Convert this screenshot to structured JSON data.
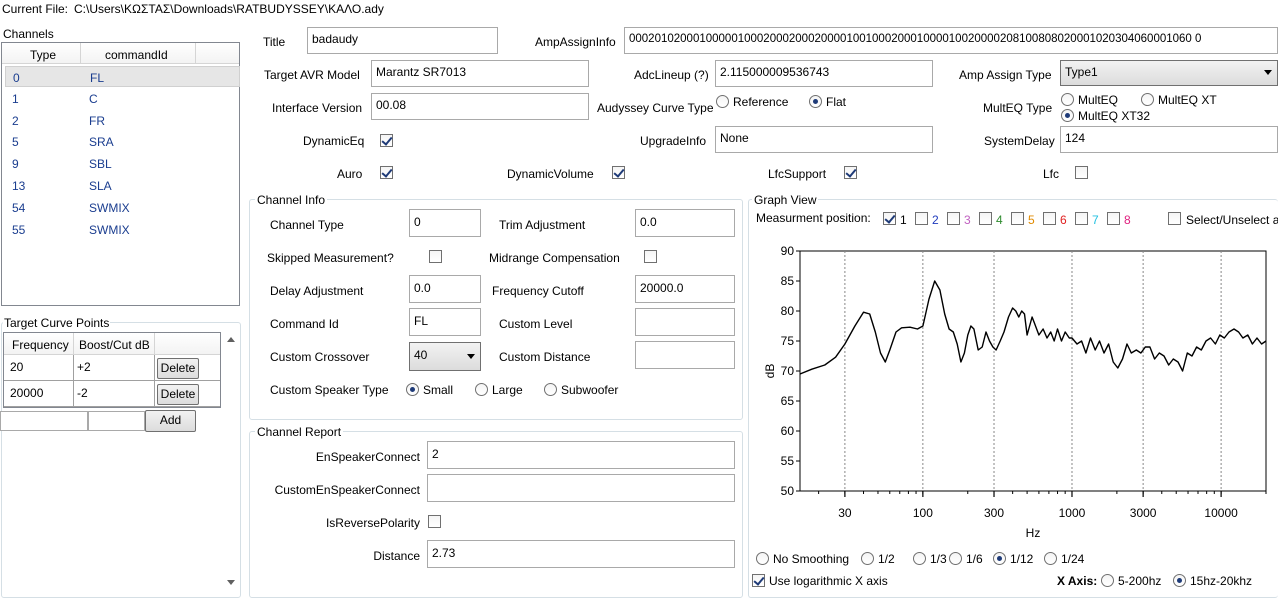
{
  "current_file": {
    "label": "Current File:",
    "path": "C:\\Users\\ΚΩΣΤΑΣ\\Downloads\\RATBUDYSSEY\\ΚΑΛΟ.ady"
  },
  "channels": {
    "title": "Channels",
    "headers": {
      "type": "Type",
      "command": "commandId"
    },
    "rows": [
      {
        "type": "0",
        "cmd": "FL"
      },
      {
        "type": "1",
        "cmd": "C"
      },
      {
        "type": "2",
        "cmd": "FR"
      },
      {
        "type": "5",
        "cmd": "SRA"
      },
      {
        "type": "9",
        "cmd": "SBL"
      },
      {
        "type": "13",
        "cmd": "SLA"
      },
      {
        "type": "54",
        "cmd": "SWMIX"
      },
      {
        "type": "55",
        "cmd": "SWMIX"
      }
    ]
  },
  "target_curve": {
    "title": "Target Curve Points",
    "headers": {
      "freq": "Frequency",
      "boost": "Boost/Cut dB"
    },
    "rows": [
      {
        "freq": "20",
        "boost": "+2",
        "del": "Delete"
      },
      {
        "freq": "20000",
        "boost": "-2",
        "del": "Delete"
      }
    ],
    "add_label": "Add"
  },
  "top": {
    "title_label": "Title",
    "title_value": "badaudy",
    "amp_assign_info_label": "AmpAssignInfo",
    "amp_assign_info_value": "0002010200010000010002000200020000100100020001000010020000208100808020001020304060001060 0",
    "target_avr_label": "Target AVR Model",
    "target_avr_value": "Marantz SR7013",
    "adc_lineup_label": "AdcLineup (?)",
    "adc_lineup_value": "2.115000009536743",
    "amp_assign_type_label": "Amp Assign Type",
    "amp_assign_type_value": "Type1",
    "interface_version_label": "Interface Version",
    "interface_version_value": "00.08",
    "audyssey_curve_label": "Audyssey Curve Type",
    "curve_reference": "Reference",
    "curve_flat": "Flat",
    "multeq_type_label": "MultEQ Type",
    "multeq": "MultEQ",
    "multeq_xt": "MultEQ XT",
    "multeq_xt32": "MultEQ XT32",
    "dynamic_eq_label": "DynamicEq",
    "upgrade_info_label": "UpgradeInfo",
    "upgrade_info_value": "None",
    "system_delay_label": "SystemDelay",
    "system_delay_value": "124",
    "auro_label": "Auro",
    "dynamic_volume_label": "DynamicVolume",
    "lfc_support_label": "LfcSupport",
    "lfc_label": "Lfc"
  },
  "channel_info": {
    "title": "Channel Info",
    "channel_type_label": "Channel Type",
    "channel_type_value": "0",
    "trim_label": "Trim Adjustment",
    "trim_value": "0.0",
    "skipped_label": "Skipped Measurement?",
    "midrange_label": "Midrange Compensation",
    "delay_label": "Delay Adjustment",
    "delay_value": "0.0",
    "freq_cutoff_label": "Frequency Cutoff",
    "freq_cutoff_value": "20000.0",
    "command_id_label": "Command Id",
    "command_id_value": "FL",
    "custom_level_label": "Custom Level",
    "custom_level_value": "",
    "custom_crossover_label": "Custom Crossover",
    "custom_crossover_value": "40",
    "custom_distance_label": "Custom Distance",
    "custom_distance_value": "",
    "speaker_type_label": "Custom Speaker Type",
    "small": "Small",
    "large": "Large",
    "subwoofer": "Subwoofer"
  },
  "channel_report": {
    "title": "Channel Report",
    "en_speaker_label": "EnSpeakerConnect",
    "en_speaker_value": "2",
    "custom_en_label": "CustomEnSpeakerConnect",
    "custom_en_value": "",
    "reverse_label": "IsReversePolarity",
    "distance_label": "Distance",
    "distance_value": "2.73"
  },
  "graph": {
    "title": "Graph View",
    "measurement_label": "Measurment position:",
    "positions": [
      {
        "n": "1",
        "color": "#000000",
        "checked": true
      },
      {
        "n": "2",
        "color": "#1f3bbd",
        "checked": false
      },
      {
        "n": "3",
        "color": "#c060c0",
        "checked": false
      },
      {
        "n": "4",
        "color": "#2e8b2e",
        "checked": false
      },
      {
        "n": "5",
        "color": "#e08a00",
        "checked": false
      },
      {
        "n": "6",
        "color": "#e02020",
        "checked": false
      },
      {
        "n": "7",
        "color": "#20c0e0",
        "checked": false
      },
      {
        "n": "8",
        "color": "#e0207f",
        "checked": false
      }
    ],
    "select_all_label": "Select/Unselect all",
    "smoothing": [
      "No Smoothing",
      "1/2",
      "1/3",
      "1/6",
      "1/12",
      "1/24"
    ],
    "smoothing_selected": 4,
    "log_axis_label": "Use logarithmic X axis",
    "x_axis_label": "X Axis:",
    "x_range_1": "5-200hz",
    "x_range_2": "15hz-20khz"
  },
  "chart_data": {
    "type": "line",
    "xlabel": "Hz",
    "ylabel": "dB",
    "ylim": [
      50,
      90
    ],
    "xlim": [
      15,
      20000
    ],
    "x_scale": "log",
    "yticks": [
      50,
      55,
      60,
      65,
      70,
      75,
      80,
      85,
      90
    ],
    "xticks": [
      30,
      100,
      300,
      1000,
      3000,
      10000
    ],
    "xtick_labels": [
      "30",
      "100",
      "300",
      "1000",
      "3000",
      "10000"
    ],
    "grid": "vertical",
    "series": [
      {
        "name": "1",
        "color": "#000000",
        "points": [
          [
            15,
            69.5
          ],
          [
            18,
            70.3
          ],
          [
            22,
            71
          ],
          [
            26,
            72.3
          ],
          [
            30,
            74.5
          ],
          [
            35,
            77.5
          ],
          [
            40,
            79.8
          ],
          [
            44,
            79.5
          ],
          [
            48,
            76.5
          ],
          [
            52,
            73
          ],
          [
            56,
            71.5
          ],
          [
            60,
            73.5
          ],
          [
            66,
            76.5
          ],
          [
            72,
            77.2
          ],
          [
            82,
            77.3
          ],
          [
            92,
            77
          ],
          [
            100,
            77.5
          ],
          [
            110,
            82
          ],
          [
            120,
            85
          ],
          [
            130,
            83.5
          ],
          [
            140,
            79.5
          ],
          [
            150,
            77
          ],
          [
            160,
            76.5
          ],
          [
            170,
            74.5
          ],
          [
            180,
            71.5
          ],
          [
            190,
            73
          ],
          [
            200,
            76
          ],
          [
            210,
            77.5
          ],
          [
            220,
            77
          ],
          [
            235,
            73.5
          ],
          [
            250,
            74
          ],
          [
            265,
            76.5
          ],
          [
            280,
            75
          ],
          [
            295,
            74
          ],
          [
            310,
            73.5
          ],
          [
            330,
            75
          ],
          [
            350,
            76.5
          ],
          [
            375,
            79
          ],
          [
            400,
            80.5
          ],
          [
            420,
            80
          ],
          [
            440,
            79
          ],
          [
            460,
            80
          ],
          [
            480,
            79.5
          ],
          [
            500,
            76
          ],
          [
            520,
            77.5
          ],
          [
            540,
            79
          ],
          [
            560,
            78
          ],
          [
            600,
            76
          ],
          [
            640,
            77
          ],
          [
            680,
            75.5
          ],
          [
            720,
            76.5
          ],
          [
            760,
            75
          ],
          [
            800,
            77
          ],
          [
            850,
            75
          ],
          [
            900,
            76.5
          ],
          [
            960,
            75.5
          ],
          [
            1000,
            75.5
          ],
          [
            1080,
            74.5
          ],
          [
            1160,
            75
          ],
          [
            1240,
            73
          ],
          [
            1330,
            75.5
          ],
          [
            1430,
            73.5
          ],
          [
            1530,
            75
          ],
          [
            1640,
            73
          ],
          [
            1760,
            74.5
          ],
          [
            1890,
            71.5
          ],
          [
            2030,
            70.5
          ],
          [
            2180,
            72
          ],
          [
            2340,
            74.5
          ],
          [
            2500,
            73
          ],
          [
            2700,
            73.5
          ],
          [
            2900,
            73
          ],
          [
            3100,
            74
          ],
          [
            3330,
            74
          ],
          [
            3580,
            72
          ],
          [
            3850,
            73
          ],
          [
            4140,
            72.5
          ],
          [
            4450,
            71
          ],
          [
            4780,
            72
          ],
          [
            5140,
            71.5
          ],
          [
            5520,
            70
          ],
          [
            5930,
            73
          ],
          [
            6380,
            72.5
          ],
          [
            6850,
            74
          ],
          [
            7370,
            73.5
          ],
          [
            7920,
            75
          ],
          [
            8500,
            75.5
          ],
          [
            9150,
            74.5
          ],
          [
            9800,
            76
          ],
          [
            10500,
            75.5
          ],
          [
            11300,
            76.5
          ],
          [
            12200,
            77
          ],
          [
            13100,
            76.5
          ],
          [
            14000,
            75.5
          ],
          [
            15100,
            76
          ],
          [
            16200,
            74.5
          ],
          [
            17400,
            75.5
          ],
          [
            18700,
            74.5
          ],
          [
            20000,
            75
          ]
        ]
      }
    ]
  }
}
